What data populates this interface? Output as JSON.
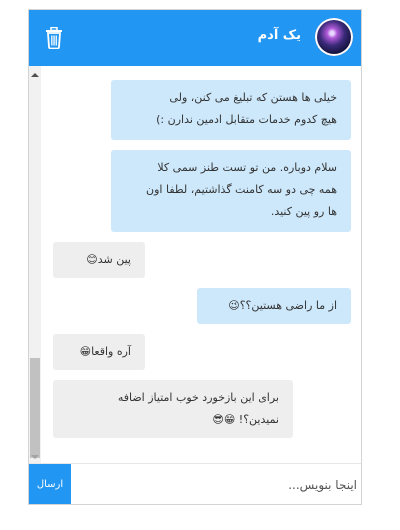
{
  "header": {
    "name": "یک آدم",
    "avatar_icon": "galaxy-avatar",
    "trash_icon": "trash-icon",
    "color": "#2196f3"
  },
  "messages": [
    {
      "side": "sent",
      "lines": [
        "خیلی ها هستن که تبلیغ می کنن، ولی",
        "هیچ کدوم خدمات متقابل ادمین ندارن :)"
      ]
    },
    {
      "side": "sent",
      "lines": [
        "سلام دوباره. من تو تست طنز سمی کلا",
        "همه چی دو سه کامنت گذاشتیم، لطفا اون",
        "ها رو پین کنید."
      ]
    },
    {
      "side": "received",
      "lines": [
        "پین شد😊"
      ]
    },
    {
      "side": "sent",
      "lines": [
        "از ما راضی هستین؟؟😉"
      ]
    },
    {
      "side": "received",
      "lines": [
        "آره واقعا😁"
      ]
    },
    {
      "side": "received",
      "lines": [
        "برای این بازخورد خوب امتیاز اضافه",
        "نمیدین؟! 😁😎"
      ]
    }
  ],
  "composer": {
    "placeholder": "اینجا بنویس...",
    "send_label": "ارسال"
  },
  "colors": {
    "sent_bubble": "#cde8fb",
    "received_bubble": "#eeeeee"
  }
}
